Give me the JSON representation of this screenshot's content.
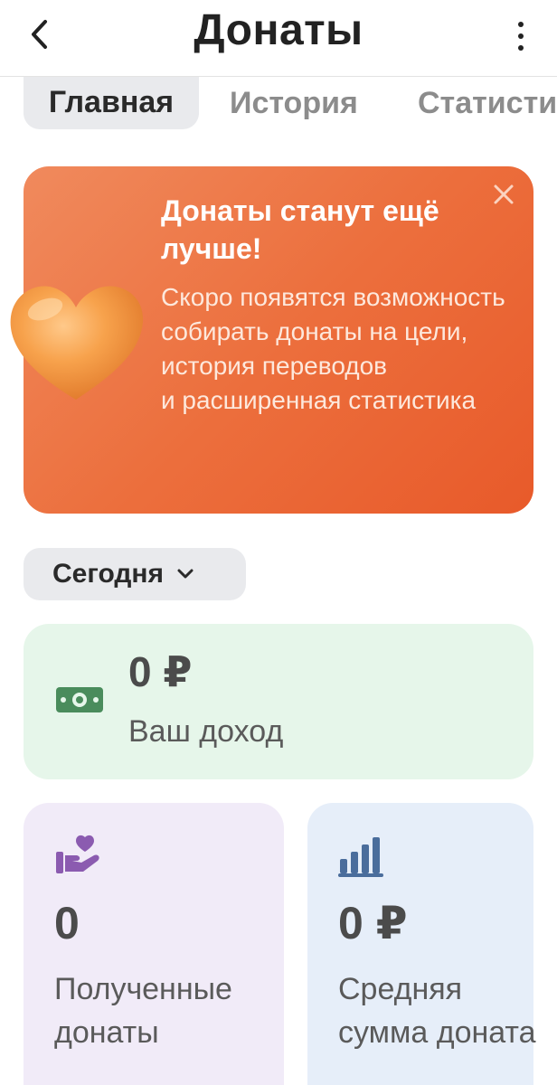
{
  "header": {
    "title": "Донаты"
  },
  "tabs": [
    {
      "label": "Главная",
      "active": true
    },
    {
      "label": "История",
      "active": false
    },
    {
      "label": "Статистика",
      "active": false
    }
  ],
  "promo": {
    "title": "Донаты станут ещё лучше!",
    "text": "Скоро появятся возможность собирать донаты на цели, история переводов\nи расширенная статистика",
    "colors": {
      "from": "#f08a5d",
      "to": "#e85a2a"
    }
  },
  "period": {
    "selected": "Сегодня"
  },
  "stats": {
    "income": {
      "value": "0 ₽",
      "label": "Ваш доход",
      "icon": "money-icon",
      "color": "#4a8c5c"
    },
    "donations": {
      "value": "0",
      "label": "Полученные донаты",
      "icon": "hand-heart-icon",
      "color": "#8b5bb0"
    },
    "average": {
      "value": "0 ₽",
      "label": "Средняя сумма доната",
      "icon": "bar-chart-icon",
      "color": "#4a6d9c"
    }
  }
}
